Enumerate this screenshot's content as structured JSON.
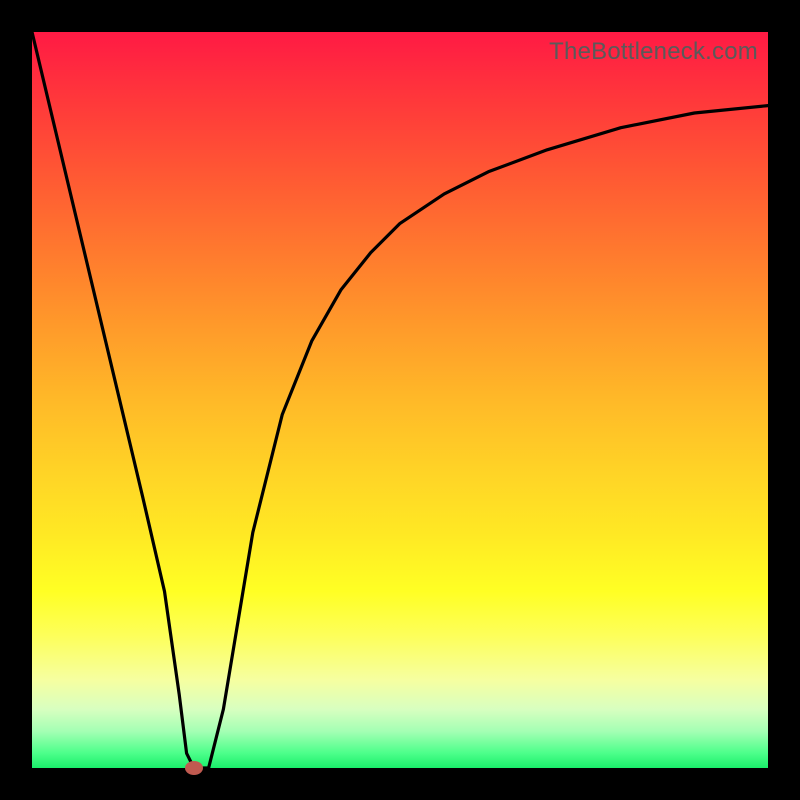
{
  "watermark": "TheBottleneck.com",
  "chart_data": {
    "type": "line",
    "title": "",
    "xlabel": "",
    "ylabel": "",
    "xlim": [
      0,
      100
    ],
    "ylim": [
      0,
      100
    ],
    "series": [
      {
        "name": "curve",
        "x": [
          0,
          5,
          10,
          15,
          18,
          20,
          21,
          22,
          24,
          26,
          28,
          30,
          34,
          38,
          42,
          46,
          50,
          56,
          62,
          70,
          80,
          90,
          100
        ],
        "y": [
          100,
          79,
          58,
          37,
          24,
          10,
          2,
          0,
          0,
          8,
          20,
          32,
          48,
          58,
          65,
          70,
          74,
          78,
          81,
          84,
          87,
          89,
          90
        ]
      }
    ],
    "marker": {
      "x": 22,
      "y": 0,
      "color": "#c05a50"
    },
    "gradient_stops": [
      {
        "pos": 0,
        "color": "#ff1a44"
      },
      {
        "pos": 40,
        "color": "#ff9a2a"
      },
      {
        "pos": 76,
        "color": "#ffff24"
      },
      {
        "pos": 100,
        "color": "#1aee6a"
      }
    ]
  }
}
